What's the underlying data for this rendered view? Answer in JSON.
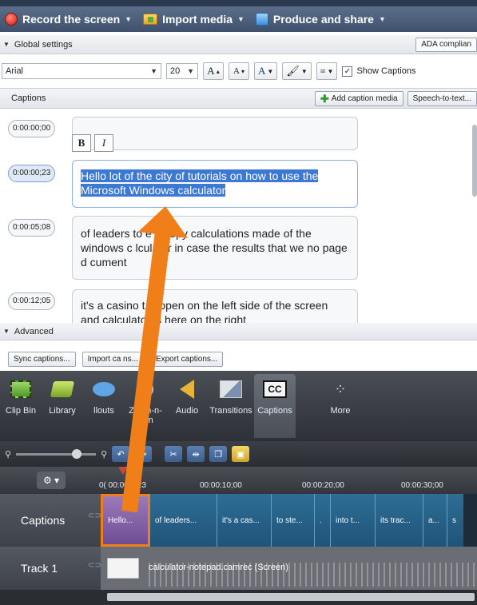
{
  "toolbar": {
    "record": "Record the screen",
    "import": "Import media",
    "produce": "Produce and share"
  },
  "global_settings": {
    "title": "Global settings",
    "ada_button": "ADA complian"
  },
  "font": {
    "family": "Arial",
    "size": "20",
    "grow": "A",
    "shrink": "A",
    "color": "A",
    "show_captions": "Show Captions"
  },
  "captions_panel": {
    "title": "Captions",
    "add_caption_media": "Add caption media",
    "speech_to_text": "Speech-to-text..."
  },
  "caption_items": [
    {
      "time": "0:00:00;00",
      "text": ""
    },
    {
      "time": "0:00:00;23",
      "text": "Hello lot of the city of tutorials on how to use the Microsoft Windows calculator"
    },
    {
      "time": "0:00:05;08",
      "text": "of leaders to    e a copy calculations made of the windows c  lculator in case the results that we no page d  cument"
    },
    {
      "time": "0:00:12;05",
      "text": "it's a casino    t is open on the left side of the screen and     calculator is here on the right"
    }
  ],
  "format_buttons": {
    "bold": "B",
    "italic": "I"
  },
  "advanced": {
    "title": "Advanced",
    "sync": "Sync captions...",
    "import": "Import ca     ns...",
    "export": "Export captions..."
  },
  "tools": [
    {
      "label": "Clip Bin",
      "icon": "film-strip-icon"
    },
    {
      "label": "Library",
      "icon": "library-icon"
    },
    {
      "label": "    llouts",
      "icon": "callout-icon"
    },
    {
      "label": "Zoom-n-\nPan",
      "icon": "magnifier-icon"
    },
    {
      "label": "Audio",
      "icon": "speaker-icon"
    },
    {
      "label": "Transitions",
      "icon": "transitions-icon"
    },
    {
      "label": "Captions",
      "icon": "cc-icon"
    },
    {
      "label": "More",
      "icon": "more-icon"
    }
  ],
  "timeline": {
    "ruler": [
      "0( 00:00    0;23",
      "00:00:10;00",
      "00:00:20;00",
      "00:00:30;00"
    ],
    "tracks": [
      {
        "label": "Captions",
        "clips": [
          "Hello...",
          "of leaders...",
          "it's a cas...",
          "to ste...",
          ".",
          "into t...",
          "its trac...",
          "a...",
          "s"
        ]
      },
      {
        "label": "Track 1",
        "media": "calculator-notepad.camrec (Screen)"
      }
    ]
  },
  "colors": {
    "highlight": "#3b79d4",
    "arrow": "#f07f1a",
    "selected_clip": "#8a64aa"
  }
}
